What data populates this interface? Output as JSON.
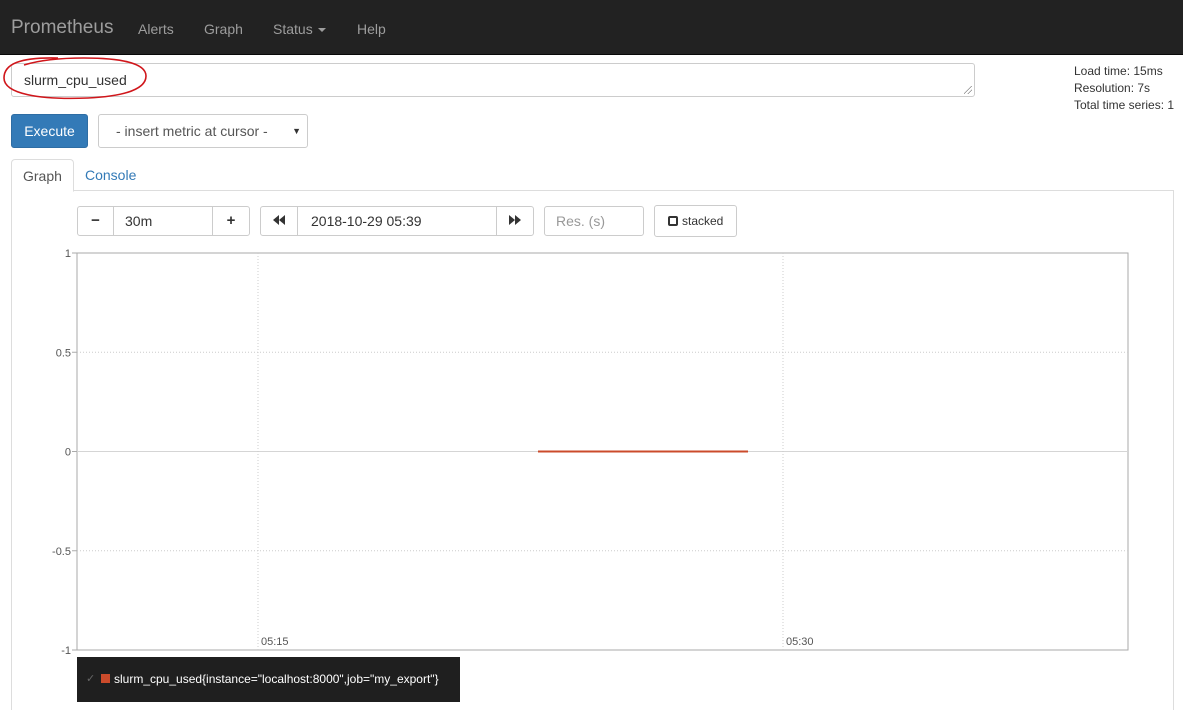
{
  "nav": {
    "brand": "Prometheus",
    "items": [
      {
        "label": "Alerts"
      },
      {
        "label": "Graph"
      },
      {
        "label": "Status"
      },
      {
        "label": "Help"
      }
    ]
  },
  "query": {
    "expression": "slurm_cpu_used",
    "annotation": "red hand-drawn circle around expression"
  },
  "stats": {
    "load_time": "Load time: 15ms",
    "resolution": "Resolution: 7s",
    "total_series": "Total time series: 1"
  },
  "actions": {
    "execute_label": "Execute",
    "metric_select_value": "- insert metric at cursor -"
  },
  "tabs": [
    {
      "label": "Graph",
      "active": true
    },
    {
      "label": "Console",
      "active": false
    }
  ],
  "controls": {
    "range_minus": "−",
    "range_value": "30m",
    "range_plus": "+",
    "back_icon": "double-left-arrow",
    "end_time": "2018-10-29 05:39",
    "forward_icon": "double-right-arrow",
    "resolution_placeholder": "Res. (s)",
    "stacked_label": "stacked"
  },
  "chart_data": {
    "type": "line",
    "ylim": [
      -1,
      1
    ],
    "y_ticks": [
      "1",
      "0.5",
      "0",
      "-0.5",
      "-1"
    ],
    "x_ticks": [
      "05:15",
      "05:30"
    ],
    "grid": true,
    "series": [
      {
        "name": "slurm_cpu_used{instance=\"localhost:8000\",job=\"my_export\"}",
        "color": "#cb4b2b",
        "x": [
          "05:23",
          "05:29"
        ],
        "y": [
          0,
          0
        ]
      }
    ]
  },
  "legend": {
    "label": "slurm_cpu_used{instance=\"localhost:8000\",job=\"my_export\"}",
    "color": "#cb4b2b",
    "check": "✓"
  }
}
